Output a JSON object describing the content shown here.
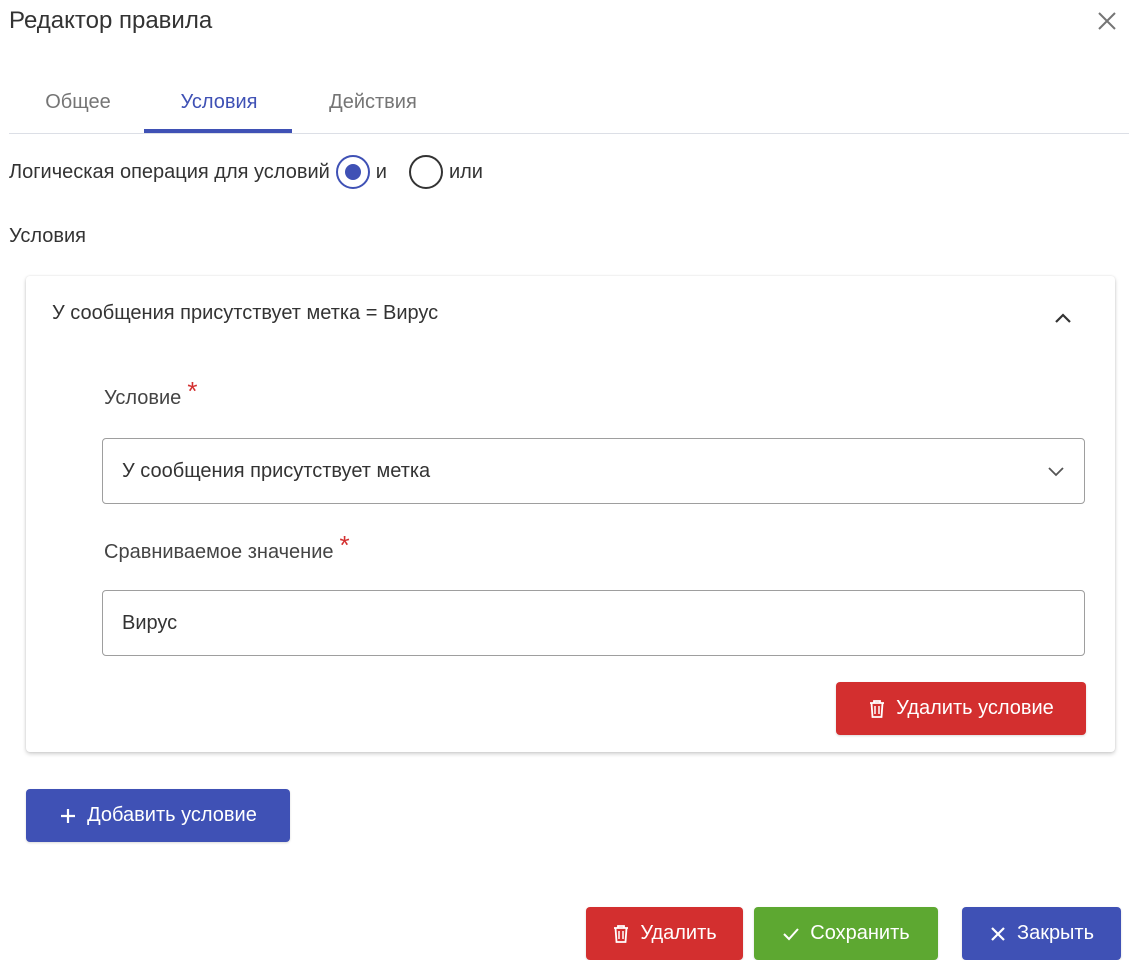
{
  "dialog": {
    "title": "Редактор правила"
  },
  "tabs": [
    {
      "label": "Общее"
    },
    {
      "label": "Условия"
    },
    {
      "label": "Действия"
    }
  ],
  "active_tab": "Условия",
  "logic": {
    "label": "Логическая операция для условий",
    "options": [
      {
        "label": "и",
        "selected": true
      },
      {
        "label": "или",
        "selected": false
      }
    ]
  },
  "conditions_section": {
    "title": "Условия"
  },
  "condition_panel": {
    "summary": "У сообщения присутствует метка = Вирус",
    "condition_label": "Условие",
    "condition_value": "У сообщения присутствует метка",
    "compare_label": "Сравниваемое значение",
    "compare_value": "Вирус",
    "required_mark": "*",
    "delete_condition_label": "Удалить условие"
  },
  "add_condition_label": "Добавить условие",
  "footer": {
    "delete_label": "Удалить",
    "save_label": "Сохранить",
    "close_label": "Закрыть"
  },
  "colors": {
    "primary": "#3f51b5",
    "danger": "#d32f2f",
    "success": "#5da831"
  },
  "icons": {
    "close": "close-icon",
    "chevron_up": "chevron-up-icon",
    "chevron_down": "chevron-down-icon",
    "trash": "trash-icon",
    "plus": "plus-icon",
    "check": "check-icon"
  }
}
